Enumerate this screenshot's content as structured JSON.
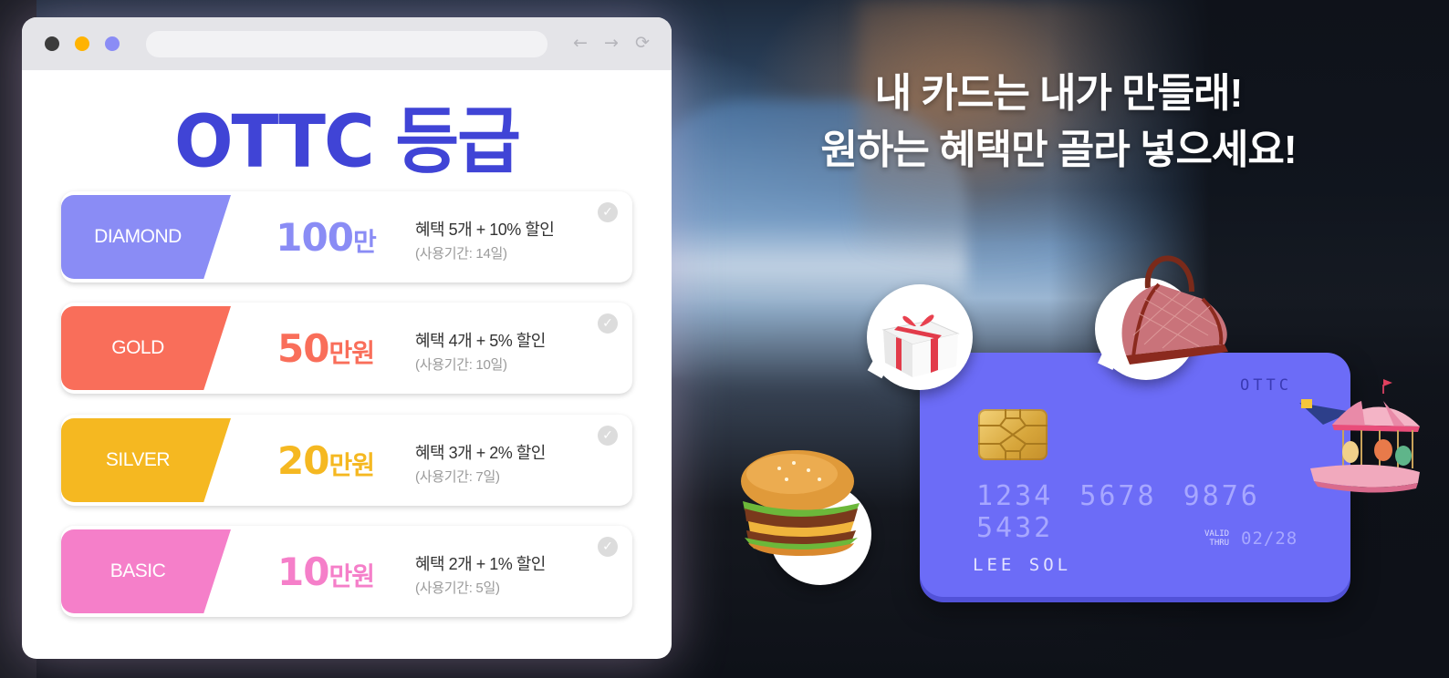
{
  "browser": {
    "nav_back": "←",
    "nav_forward": "→",
    "nav_reload": "⟳",
    "title": "OTTC 등급"
  },
  "tiers": [
    {
      "name": "DIAMOND",
      "amount": "100",
      "unit": "만",
      "benefit": "혜택 5개 + 10% 할인",
      "period": "(사용기간: 14일)",
      "color": "#8a8cf5",
      "check": "✓"
    },
    {
      "name": "GOLD",
      "amount": "50",
      "unit": "만원",
      "benefit": "혜택 4개 + 5% 할인",
      "period": "(사용기간: 10일)",
      "color": "#f96e5a",
      "check": "✓"
    },
    {
      "name": "SILVER",
      "amount": "20",
      "unit": "만원",
      "benefit": "혜택 3개 + 2% 할인",
      "period": "(사용기간: 7일)",
      "color": "#f5b821",
      "check": "✓"
    },
    {
      "name": "BASIC",
      "amount": "10",
      "unit": "만원",
      "benefit": "혜택 2개 + 1% 할인",
      "period": "(사용기간: 5일)",
      "color": "#f57fc9",
      "check": "✓"
    }
  ],
  "headline": {
    "line1": "내 카드는 내가 만들래!",
    "line2": "원하는 혜택만 골라 넣으세요!"
  },
  "card": {
    "brand": "OTTC",
    "number": "1234 5678 9876 5432",
    "valid_line1": "VALID",
    "valid_line2": "THRU",
    "expiry": "02/28",
    "holder": "LEE SOL",
    "color": "#6c6cf7"
  },
  "stickers": [
    "gift-icon",
    "handbag-icon",
    "burger-icon",
    "carousel-icon"
  ]
}
